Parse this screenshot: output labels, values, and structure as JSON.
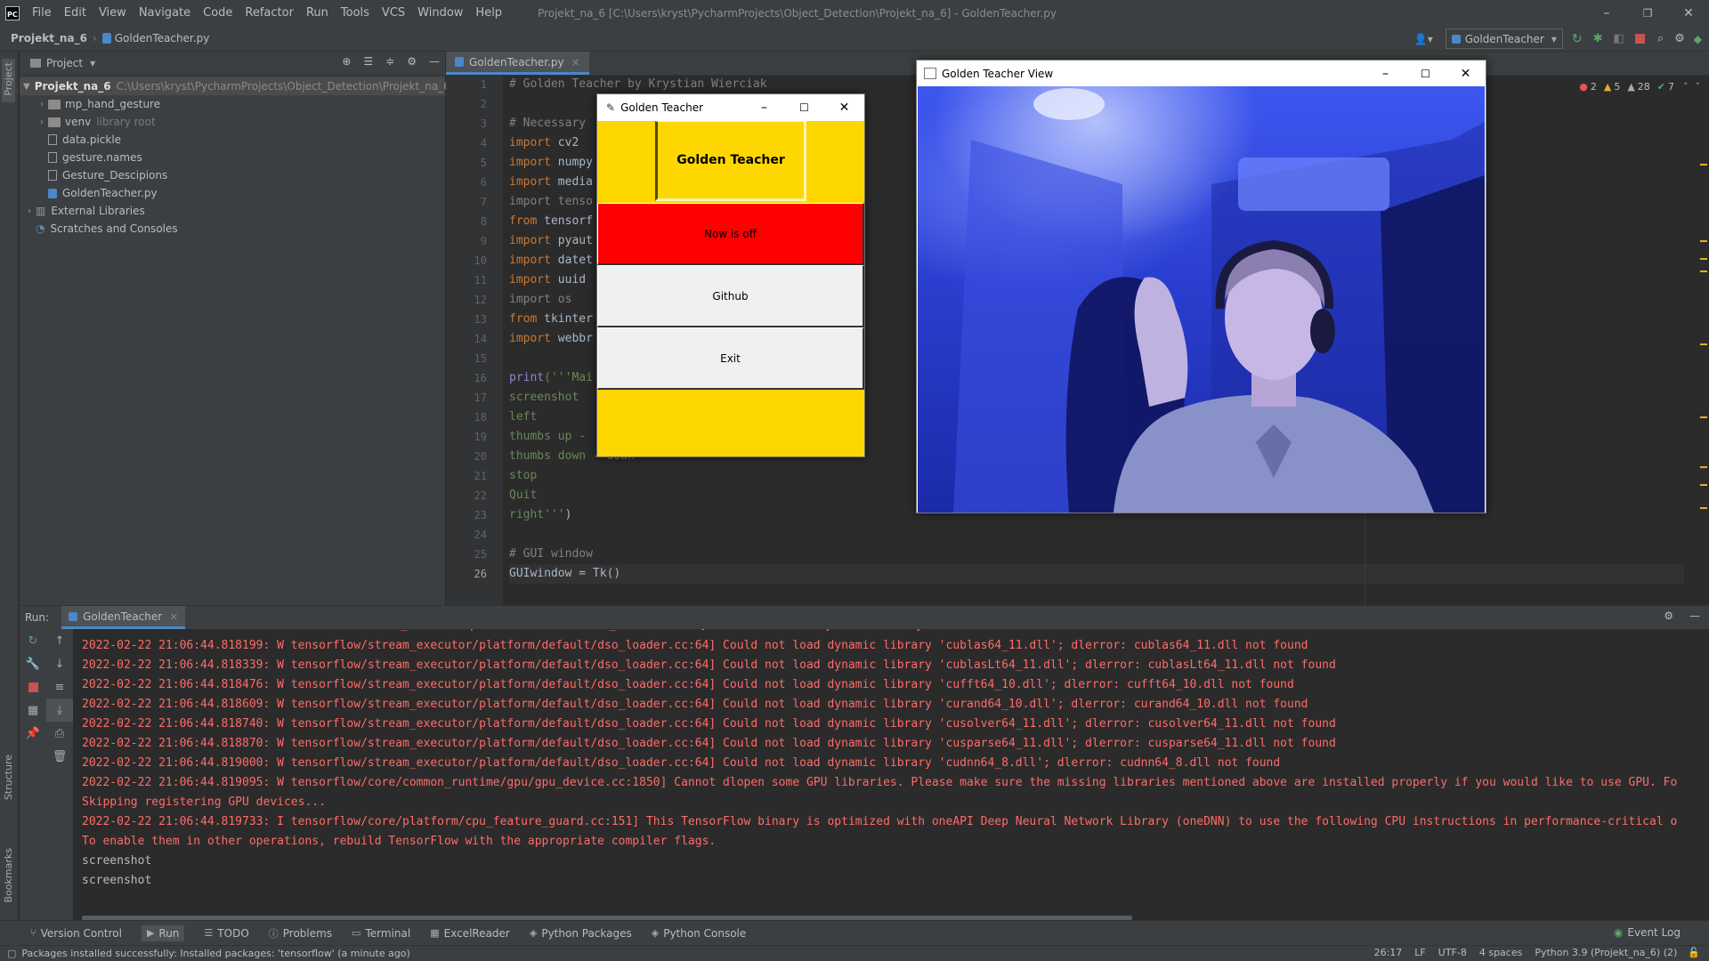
{
  "titlebar": {
    "logo": "PC",
    "menu": [
      "File",
      "Edit",
      "View",
      "Navigate",
      "Code",
      "Refactor",
      "Run",
      "Tools",
      "VCS",
      "Window",
      "Help"
    ],
    "title": "Projekt_na_6 [C:\\Users\\kryst\\PycharmProjects\\Object_Detection\\Projekt_na_6] - GoldenTeacher.py"
  },
  "navbar": {
    "project": "Projekt_na_6",
    "file": "GoldenTeacher.py",
    "run_config": "GoldenTeacher"
  },
  "left_strip": {
    "project_label": "Project",
    "structure_label": "Structure",
    "bookmarks_label": "Bookmarks"
  },
  "project_panel": {
    "title": "Project",
    "root": {
      "name": "Projekt_na_6",
      "path": "C:\\Users\\kryst\\PycharmProjects\\Object_Detection\\Projekt_na_6"
    },
    "items": [
      {
        "name": "mp_hand_gesture",
        "kind": "folder",
        "hint": ""
      },
      {
        "name": "venv",
        "kind": "folder",
        "hint": "library root"
      },
      {
        "name": "data.pickle",
        "kind": "file",
        "hint": ""
      },
      {
        "name": "gesture.names",
        "kind": "file",
        "hint": ""
      },
      {
        "name": "Gesture_Descipions",
        "kind": "file",
        "hint": ""
      },
      {
        "name": "GoldenTeacher.py",
        "kind": "python",
        "hint": ""
      }
    ],
    "external": "External Libraries",
    "scratches": "Scratches and Consoles"
  },
  "editor": {
    "tab": "GoldenTeacher.py",
    "inspections": {
      "errors": "2",
      "warnings": "5",
      "weak": "28",
      "ok": "7"
    },
    "line_numbers": [
      "1",
      "2",
      "3",
      "4",
      "5",
      "6",
      "7",
      "8",
      "9",
      "10",
      "11",
      "12",
      "13",
      "14",
      "15",
      "16",
      "17",
      "18",
      "19",
      "20",
      "21",
      "22",
      "23",
      "24",
      "25",
      "26"
    ],
    "current_line": "26",
    "lines": [
      [
        {
          "t": "# Golden Teacher by Krystian Wierciak",
          "c": "cm"
        }
      ],
      [],
      [
        {
          "t": "# Necessary",
          "c": "cm"
        }
      ],
      [
        {
          "t": "import ",
          "c": "kw"
        },
        {
          "t": "cv2",
          "c": "id"
        }
      ],
      [
        {
          "t": "import ",
          "c": "kw"
        },
        {
          "t": "numpy",
          "c": "id"
        }
      ],
      [
        {
          "t": "import ",
          "c": "kw"
        },
        {
          "t": "media",
          "c": "id"
        }
      ],
      [
        {
          "t": "import tenso",
          "c": "cm"
        }
      ],
      [
        {
          "t": "from ",
          "c": "kw"
        },
        {
          "t": "tensorf",
          "c": "id"
        }
      ],
      [
        {
          "t": "import ",
          "c": "kw"
        },
        {
          "t": "pyaut",
          "c": "id"
        }
      ],
      [
        {
          "t": "import ",
          "c": "kw"
        },
        {
          "t": "datet",
          "c": "id"
        }
      ],
      [
        {
          "t": "import ",
          "c": "kw"
        },
        {
          "t": "uuid",
          "c": "id"
        }
      ],
      [
        {
          "t": "import os",
          "c": "cm"
        }
      ],
      [
        {
          "t": "from ",
          "c": "kw"
        },
        {
          "t": "tkinter",
          "c": "id"
        }
      ],
      [
        {
          "t": "import ",
          "c": "kw"
        },
        {
          "t": "webbr",
          "c": "id"
        }
      ],
      [],
      [
        {
          "t": "print",
          "c": "pr"
        },
        {
          "t": "('''Mai",
          "c": "st"
        }
      ],
      [
        {
          "t": "screenshot",
          "c": "st"
        }
      ],
      [
        {
          "t": "left",
          "c": "st"
        }
      ],
      [
        {
          "t": "thumbs up - ",
          "c": "st"
        }
      ],
      [
        {
          "t": "thumbs down - down",
          "c": "st"
        }
      ],
      [
        {
          "t": "stop",
          "c": "st"
        }
      ],
      [
        {
          "t": "Quit",
          "c": "st"
        }
      ],
      [
        {
          "t": "right'''",
          "c": "st"
        },
        {
          "t": ")",
          "c": "id"
        }
      ],
      [],
      [
        {
          "t": "# GUI window",
          "c": "cm"
        }
      ],
      [
        {
          "t": "GUIwindow = Tk()",
          "c": "id"
        }
      ]
    ]
  },
  "tk_window": {
    "title": "Golden Teacher",
    "header_button": "Golden Teacher",
    "buttons": [
      {
        "label": "Now is off",
        "bg": "#ff0000"
      },
      {
        "label": "Github",
        "bg": "#f0f0f0"
      },
      {
        "label": "Exit",
        "bg": "#f0f0f0"
      }
    ],
    "accent": "#ffd700"
  },
  "camera_window": {
    "title": "Golden Teacher View"
  },
  "run_panel": {
    "label": "Run:",
    "tab": "GoldenTeacher",
    "log_lines": [
      {
        "t": "2022-02-22 21:06:44.818199: W tensorflow/stream_executor/platform/default/dso_loader.cc:64] Could not load dynamic library 'cublas64_11.dll'; dlerror: cublas64_11.dll not found",
        "err": true
      },
      {
        "t": "2022-02-22 21:06:44.818339: W tensorflow/stream_executor/platform/default/dso_loader.cc:64] Could not load dynamic library 'cublasLt64_11.dll'; dlerror: cublasLt64_11.dll not found",
        "err": true
      },
      {
        "t": "2022-02-22 21:06:44.818476: W tensorflow/stream_executor/platform/default/dso_loader.cc:64] Could not load dynamic library 'cufft64_10.dll'; dlerror: cufft64_10.dll not found",
        "err": true
      },
      {
        "t": "2022-02-22 21:06:44.818609: W tensorflow/stream_executor/platform/default/dso_loader.cc:64] Could not load dynamic library 'curand64_10.dll'; dlerror: curand64_10.dll not found",
        "err": true
      },
      {
        "t": "2022-02-22 21:06:44.818740: W tensorflow/stream_executor/platform/default/dso_loader.cc:64] Could not load dynamic library 'cusolver64_11.dll'; dlerror: cusolver64_11.dll not found",
        "err": true
      },
      {
        "t": "2022-02-22 21:06:44.818870: W tensorflow/stream_executor/platform/default/dso_loader.cc:64] Could not load dynamic library 'cusparse64_11.dll'; dlerror: cusparse64_11.dll not found",
        "err": true
      },
      {
        "t": "2022-02-22 21:06:44.819000: W tensorflow/stream_executor/platform/default/dso_loader.cc:64] Could not load dynamic library 'cudnn64_8.dll'; dlerror: cudnn64_8.dll not found",
        "err": true
      },
      {
        "t": "2022-02-22 21:06:44.819095: W tensorflow/core/common_runtime/gpu/gpu_device.cc:1850] Cannot dlopen some GPU libraries. Please make sure the missing libraries mentioned above are installed properly if you would like to use GPU. Fo",
        "err": true
      },
      {
        "t": "Skipping registering GPU devices...",
        "err": true
      },
      {
        "t": "2022-02-22 21:06:44.819733: I tensorflow/core/platform/cpu_feature_guard.cc:151] This TensorFlow binary is optimized with oneAPI Deep Neural Network Library (oneDNN) to use the following CPU instructions in performance-critical o",
        "err": true
      },
      {
        "t": "To enable them in other operations, rebuild TensorFlow with the appropriate compiler flags.",
        "err": true
      },
      {
        "t": "screenshot",
        "err": false
      },
      {
        "t": "screenshot",
        "err": false
      }
    ]
  },
  "tool_windows": [
    "Version Control",
    "Run",
    "TODO",
    "Problems",
    "Terminal",
    "ExcelReader",
    "Python Packages",
    "Python Console"
  ],
  "event_log": "Event Log",
  "status": {
    "message": "Packages installed successfully: Installed packages: 'tensorflow' (a minute ago)",
    "position": "26:17",
    "line_sep": "LF",
    "encoding": "UTF-8",
    "indent": "4 spaces",
    "interpreter": "Python 3.9 (Projekt_na_6) (2)"
  }
}
